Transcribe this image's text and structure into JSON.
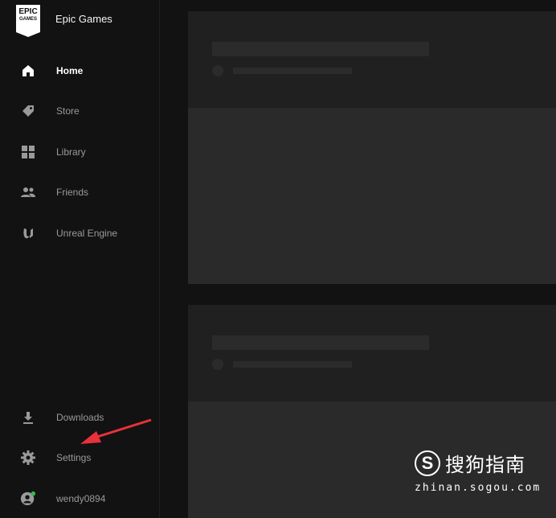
{
  "app": {
    "name": "Epic Games",
    "logo_top": "EPIC",
    "logo_bottom": "GAMES"
  },
  "nav": {
    "home": "Home",
    "store": "Store",
    "library": "Library",
    "friends": "Friends",
    "unreal": "Unreal Engine"
  },
  "bottom_nav": {
    "downloads": "Downloads",
    "settings": "Settings",
    "user": "wendy0894"
  },
  "status": {
    "online_color": "#3bb54a"
  },
  "watermark": {
    "brand": "搜狗指南",
    "url": "zhinan.sogou.com"
  },
  "colors": {
    "arrow": "#e8313b",
    "active_text": "#ffffff",
    "inactive_text": "#9a9a9a"
  }
}
